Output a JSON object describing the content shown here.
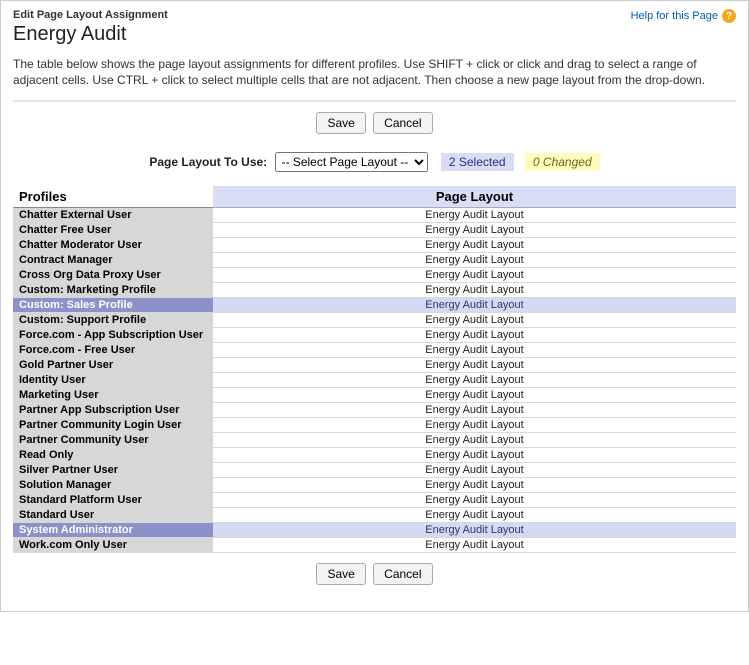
{
  "header": {
    "subtitle": "Edit Page Layout Assignment",
    "title": "Energy Audit"
  },
  "help": {
    "text": "Help for this Page",
    "icon_glyph": "?"
  },
  "intro": "The table below shows the page layout assignments for different profiles. Use SHIFT + click or click and drag to select a range of adjacent cells. Use CTRL + click to select multiple cells that are not adjacent. Then choose a new page layout from the drop-down.",
  "buttons": {
    "save": "Save",
    "cancel": "Cancel"
  },
  "selector": {
    "label": "Page Layout To Use:",
    "placeholder": "-- Select Page Layout --",
    "selected_text": "2 Selected",
    "changed_text": "0 Changed"
  },
  "table": {
    "headers": {
      "profiles": "Profiles",
      "page_layout": "Page Layout"
    },
    "rows": [
      {
        "profile": "Chatter External User",
        "layout": "Energy Audit Layout",
        "selected": false
      },
      {
        "profile": "Chatter Free User",
        "layout": "Energy Audit Layout",
        "selected": false
      },
      {
        "profile": "Chatter Moderator User",
        "layout": "Energy Audit Layout",
        "selected": false
      },
      {
        "profile": "Contract Manager",
        "layout": "Energy Audit Layout",
        "selected": false
      },
      {
        "profile": "Cross Org Data Proxy User",
        "layout": "Energy Audit Layout",
        "selected": false
      },
      {
        "profile": "Custom: Marketing Profile",
        "layout": "Energy Audit Layout",
        "selected": false
      },
      {
        "profile": "Custom: Sales Profile",
        "layout": "Energy Audit Layout",
        "selected": true
      },
      {
        "profile": "Custom: Support Profile",
        "layout": "Energy Audit Layout",
        "selected": false
      },
      {
        "profile": "Force.com - App Subscription User",
        "layout": "Energy Audit Layout",
        "selected": false
      },
      {
        "profile": "Force.com - Free User",
        "layout": "Energy Audit Layout",
        "selected": false
      },
      {
        "profile": "Gold Partner User",
        "layout": "Energy Audit Layout",
        "selected": false
      },
      {
        "profile": "Identity User",
        "layout": "Energy Audit Layout",
        "selected": false
      },
      {
        "profile": "Marketing User",
        "layout": "Energy Audit Layout",
        "selected": false
      },
      {
        "profile": "Partner App Subscription User",
        "layout": "Energy Audit Layout",
        "selected": false
      },
      {
        "profile": "Partner Community Login User",
        "layout": "Energy Audit Layout",
        "selected": false
      },
      {
        "profile": "Partner Community User",
        "layout": "Energy Audit Layout",
        "selected": false
      },
      {
        "profile": "Read Only",
        "layout": "Energy Audit Layout",
        "selected": false
      },
      {
        "profile": "Silver Partner User",
        "layout": "Energy Audit Layout",
        "selected": false
      },
      {
        "profile": "Solution Manager",
        "layout": "Energy Audit Layout",
        "selected": false
      },
      {
        "profile": "Standard Platform User",
        "layout": "Energy Audit Layout",
        "selected": false
      },
      {
        "profile": "Standard User",
        "layout": "Energy Audit Layout",
        "selected": false
      },
      {
        "profile": "System Administrator",
        "layout": "Energy Audit Layout",
        "selected": true
      },
      {
        "profile": "Work.com Only User",
        "layout": "Energy Audit Layout",
        "selected": false
      }
    ]
  }
}
